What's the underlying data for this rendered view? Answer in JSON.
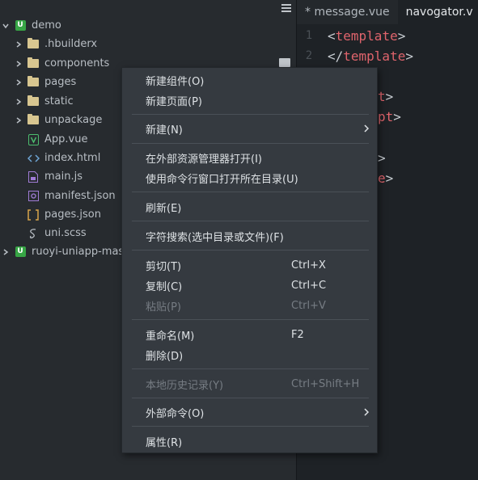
{
  "explorer": {
    "items": [
      {
        "label": "demo",
        "icon": "project-icon",
        "expanded": true
      },
      {
        "label": ".hbuilderx",
        "icon": "folder-icon"
      },
      {
        "label": "components",
        "icon": "folder-icon"
      },
      {
        "label": "pages",
        "icon": "folder-icon"
      },
      {
        "label": "static",
        "icon": "folder-icon"
      },
      {
        "label": "unpackage",
        "icon": "folder-icon"
      },
      {
        "label": "App.vue",
        "icon": "vue-file-icon"
      },
      {
        "label": "index.html",
        "icon": "html-file-icon"
      },
      {
        "label": "main.js",
        "icon": "js-file-icon"
      },
      {
        "label": "manifest.json",
        "icon": "manifest-file-icon"
      },
      {
        "label": "pages.json",
        "icon": "json-file-icon"
      },
      {
        "label": "uni.scss",
        "icon": "scss-file-icon"
      },
      {
        "label": "ruoyi-uniapp-maste",
        "icon": "project-icon",
        "expanded": false
      }
    ]
  },
  "editor": {
    "tabs": [
      {
        "label": "* message.vue",
        "active": false
      },
      {
        "label": "navogator.v",
        "active": true
      }
    ],
    "line_numbers": [
      "1",
      "2"
    ],
    "lines": [
      {
        "open": "<",
        "tag": "template",
        "close": ">"
      },
      {
        "open": "</",
        "tag": "template",
        "close": ">"
      }
    ],
    "partial": [
      "t",
      "pt",
      "",
      "e"
    ],
    "partial_punc": [
      ">",
      ">",
      ">",
      ">"
    ]
  },
  "context_menu": {
    "items": [
      {
        "label": "新建组件(O)"
      },
      {
        "label": "新建页面(P)"
      },
      {
        "label": "新建(N)",
        "submenu": true
      },
      {
        "label": "在外部资源管理器打开(I)"
      },
      {
        "label": "使用命令行窗口打开所在目录(U)"
      },
      {
        "label": "刷新(E)"
      },
      {
        "label": "字符搜索(选中目录或文件)(F)"
      },
      {
        "label": "剪切(T)",
        "shortcut": "Ctrl+X"
      },
      {
        "label": "复制(C)",
        "shortcut": "Ctrl+C"
      },
      {
        "label": "粘贴(P)",
        "shortcut": "Ctrl+V",
        "disabled": true
      },
      {
        "label": "重命名(M)",
        "shortcut": "F2"
      },
      {
        "label": "删除(D)"
      },
      {
        "label": "本地历史记录(Y)",
        "shortcut": "Ctrl+Shift+H",
        "disabled": true
      },
      {
        "label": "外部命令(O)",
        "submenu": true
      },
      {
        "label": "属性(R)"
      }
    ]
  },
  "colors": {
    "sidebar_bg": "#272b2f",
    "editor_bg": "#1e2226",
    "menu_bg": "#353a40",
    "tag_color": "#e0646c",
    "project_green": "#37a545",
    "folder_color": "#d8c690"
  }
}
